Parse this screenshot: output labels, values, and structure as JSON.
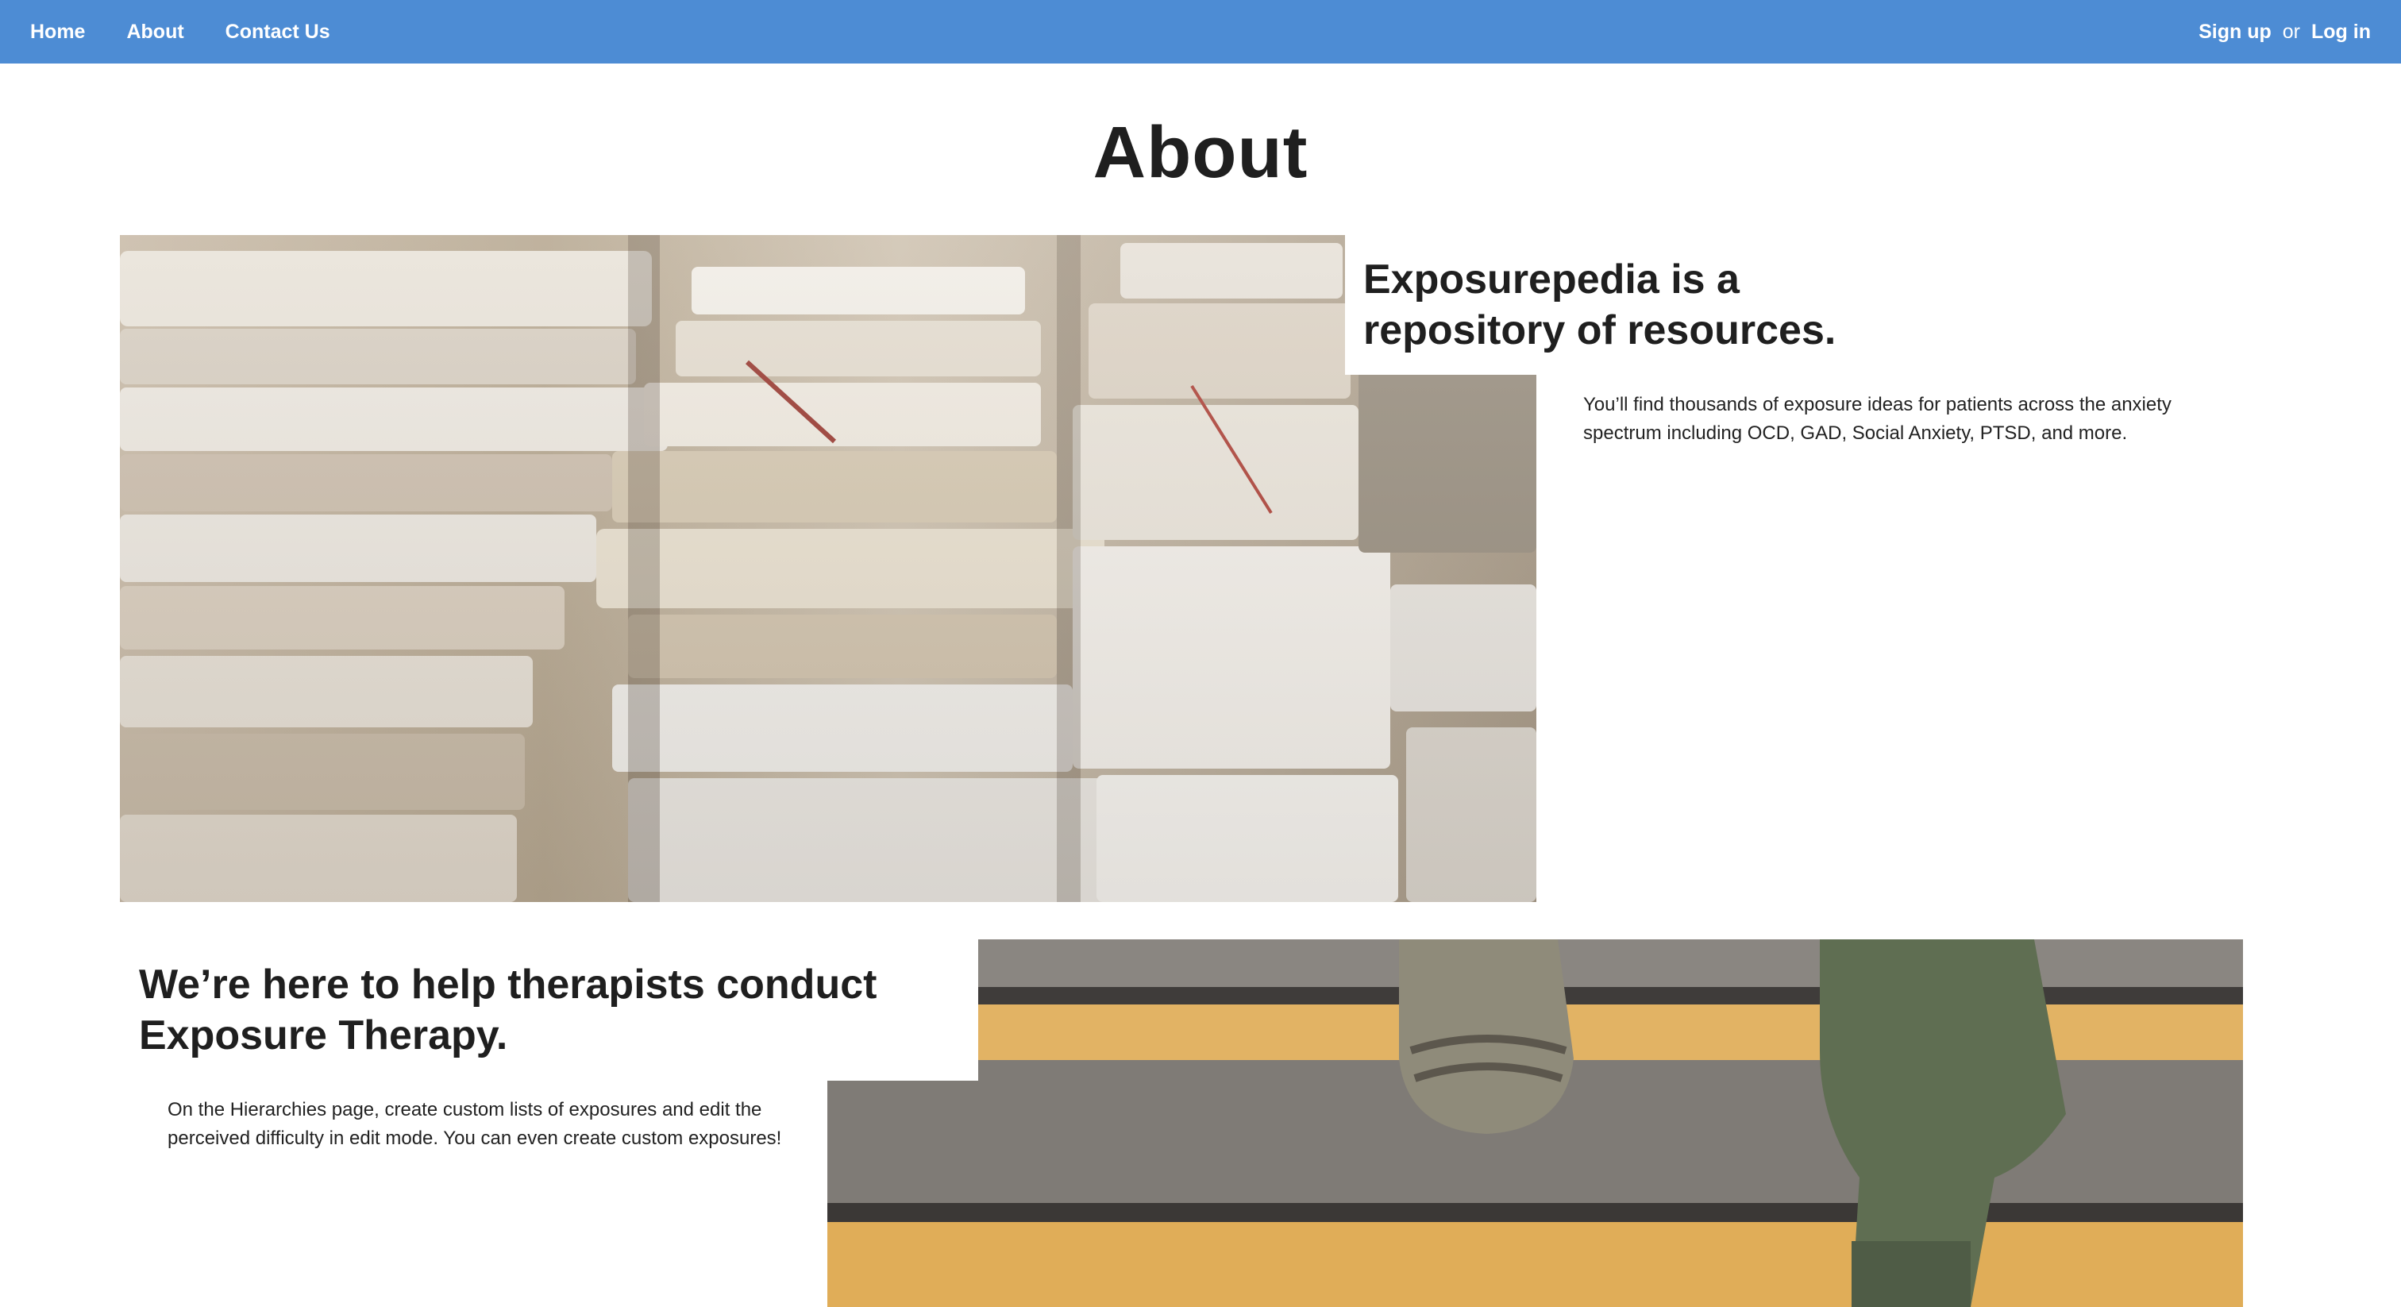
{
  "nav": {
    "home": "Home",
    "about": "About",
    "contact": "Contact Us",
    "signup": "Sign up",
    "or": "or",
    "login": "Log in"
  },
  "page": {
    "title": "About"
  },
  "section1": {
    "heading": "Exposurepedia is a repository of resources.",
    "body": "You’ll find thousands of exposure ideas for patients across the anxiety spectrum including OCD, GAD, Social Anxiety, PTSD, and more."
  },
  "section2": {
    "heading": "We’re here to help therapists conduct Exposure Therapy.",
    "body": "On the Hierarchies page, create custom lists of exposures and edit the perceived difficulty in edit mode. You can even create custom exposures!"
  },
  "colors": {
    "navbar": "#4d8cd4",
    "text": "#1f1f1f",
    "background": "#ffffff"
  }
}
